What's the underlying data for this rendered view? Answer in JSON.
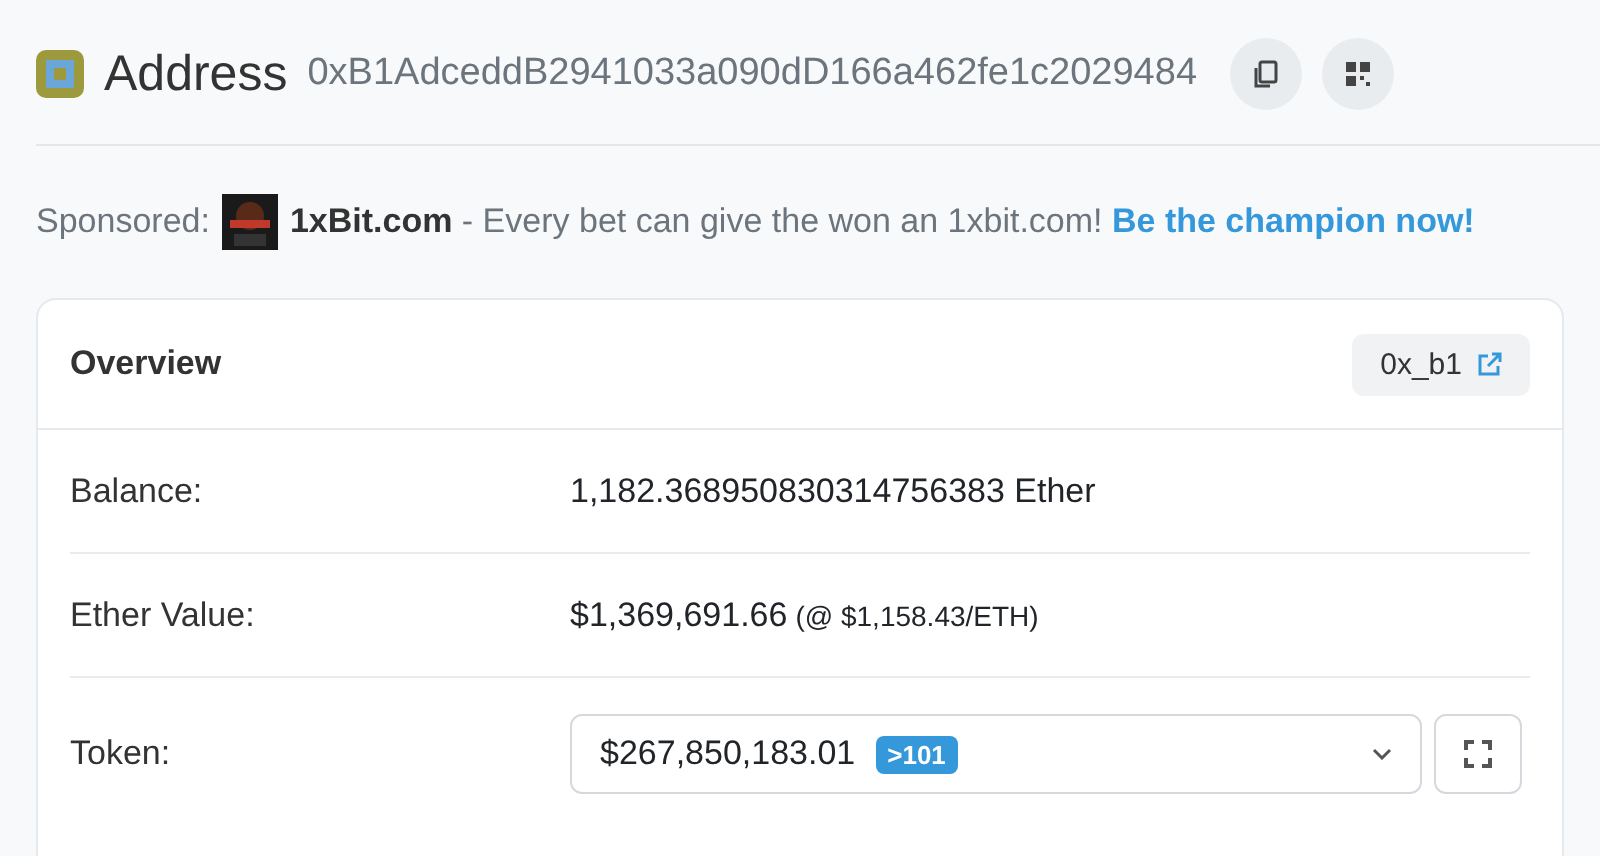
{
  "header": {
    "title": "Address",
    "address": "0xB1AdceddB2941033a090dD166a462fe1c2029484"
  },
  "sponsor": {
    "label": "Sponsored:",
    "text": "**1xBit.com** - Every bet can give the won an 1xbit.com!",
    "link": "Be the champion now!"
  },
  "overview": {
    "title": "Overview",
    "tag": "0x_b1",
    "rows": [
      {
        "kind": "text",
        "label": "Balance:",
        "value": "1,182.368950830314756383 Ether"
      },
      {
        "kind": "price",
        "label": "Ether Value:",
        "value": "$1,369,691.66",
        "note": "(@ $1,158.43/ETH)"
      },
      {
        "kind": "select",
        "label": "Token:",
        "value": "$267,850,183.01",
        "badge": ">101"
      }
    ]
  }
}
